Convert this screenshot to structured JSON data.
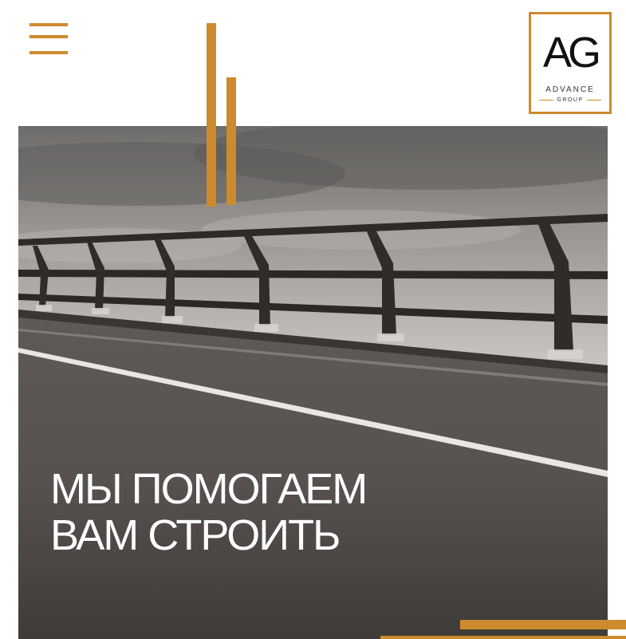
{
  "header": {
    "menu_icon": "hamburger-menu-icon",
    "logo": {
      "monogram": "AG",
      "name": "ADVANCE",
      "tagline": "GROUP"
    }
  },
  "hero": {
    "title_lines": [
      "МЫ ПОМОГАЕМ",
      "ВАМ СТРОИТЬ"
    ]
  },
  "colors": {
    "accent": "#cd8a2e",
    "background": "#ffffff",
    "hero_text": "#ffffff"
  }
}
